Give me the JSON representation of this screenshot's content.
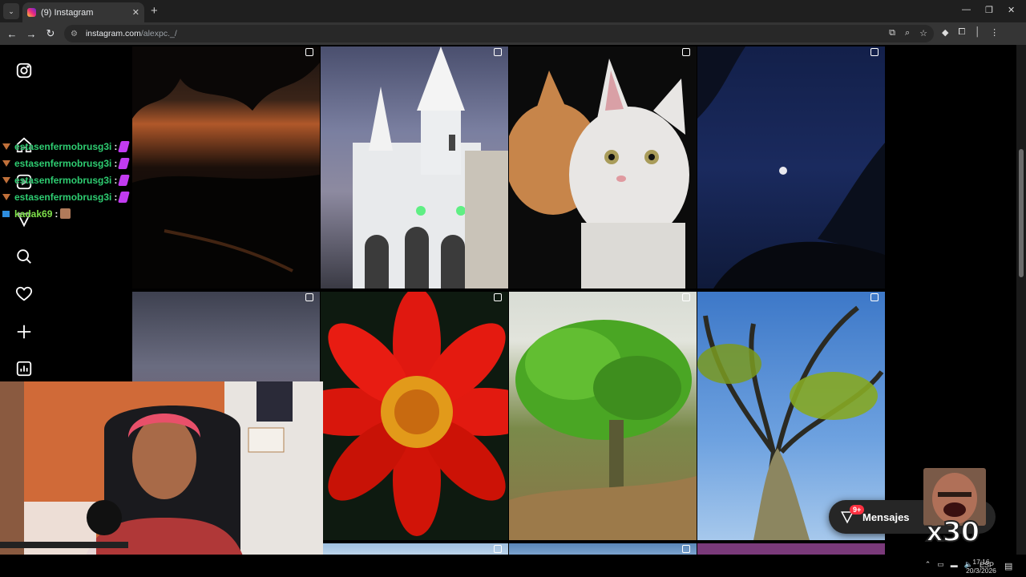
{
  "browser": {
    "tab_title": "(9) Instagram",
    "url_host": "instagram.com",
    "url_path": "/alexpc._/",
    "new_tab": "+",
    "tab_close": "✕"
  },
  "chat": {
    "messages": [
      {
        "user": "estasenfermobrusg3i",
        "colon": ":"
      },
      {
        "user": "estasenfermobrusg3i",
        "colon": ":"
      },
      {
        "user": "estasenfermobrusg3i",
        "colon": ":"
      },
      {
        "user": "estasenfermobrusg3i",
        "colon": ":"
      },
      {
        "user": "kadak69",
        "colon": ":"
      }
    ]
  },
  "messages_pill": {
    "label": "Mensajes",
    "badge": "9+"
  },
  "overlay": {
    "count": "x30"
  },
  "taskbar": {
    "lang": "ESP",
    "time": "17:16",
    "date": "20/3/2026"
  },
  "icons": {
    "sidebar": [
      "instagram-icon",
      "home-icon",
      "reels-icon",
      "explore-icon",
      "search-icon",
      "heart-icon",
      "plus-icon",
      "insights-icon"
    ]
  }
}
